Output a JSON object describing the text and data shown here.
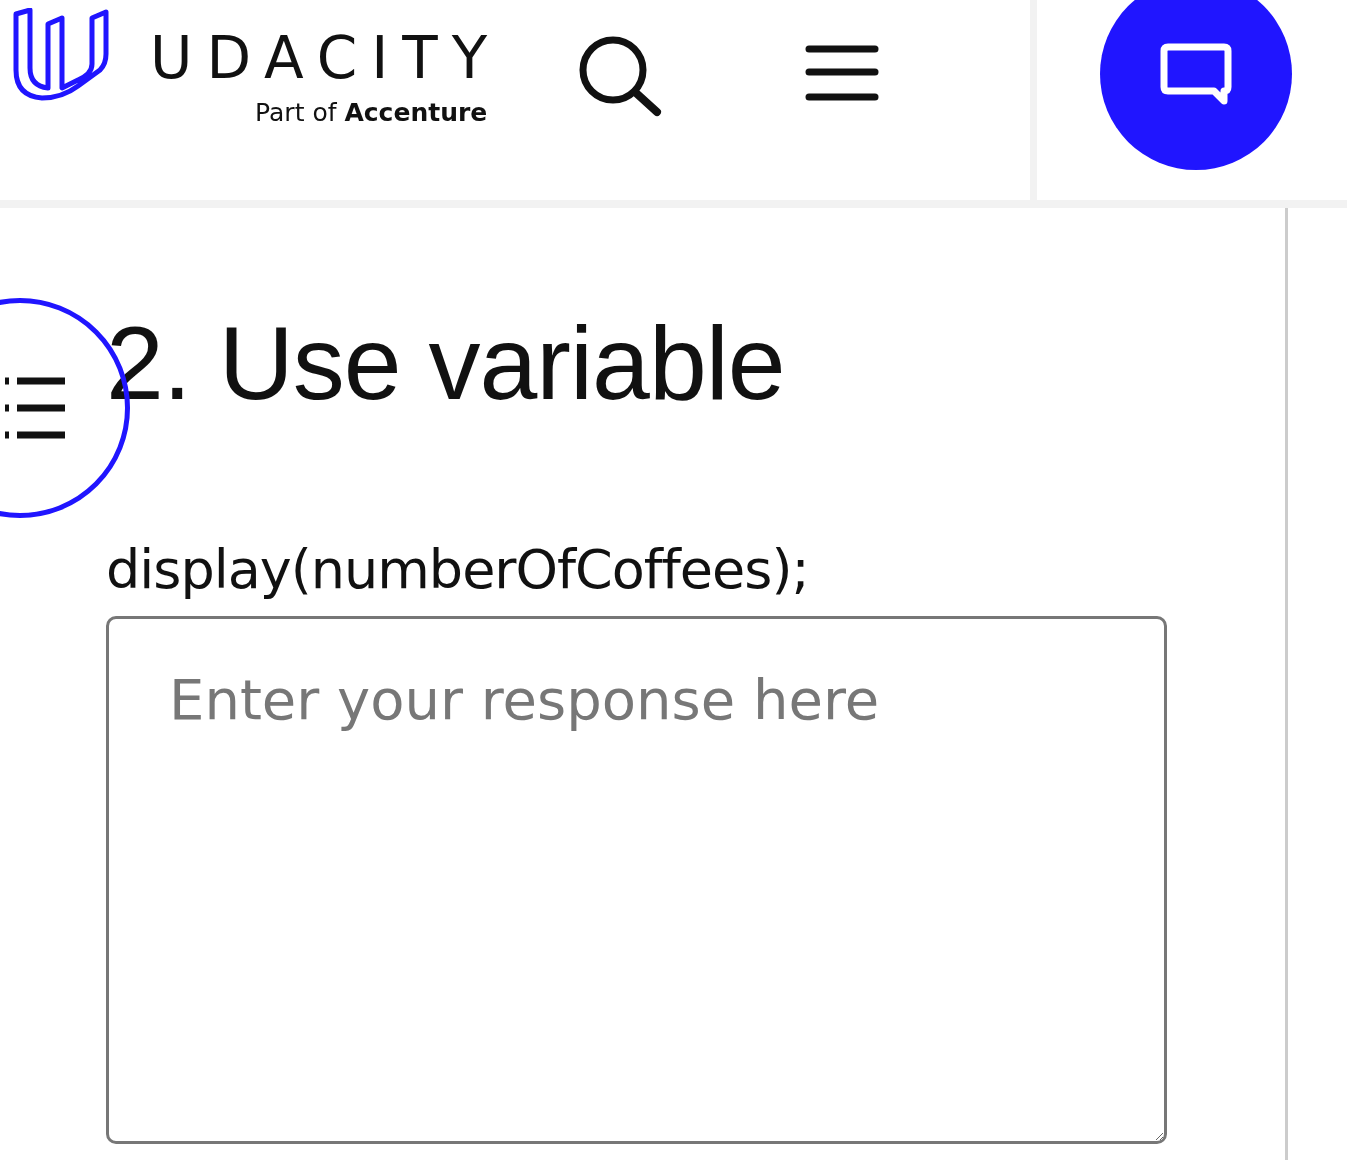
{
  "header": {
    "logo_text": "UDACITY",
    "tagline": "Part of **Accenture**"
  },
  "section": {
    "title": "2. Use variable",
    "prompt": "display(numberOfCoffees);",
    "response": {
      "placeholder": "Enter your response here"
    }
  }
}
